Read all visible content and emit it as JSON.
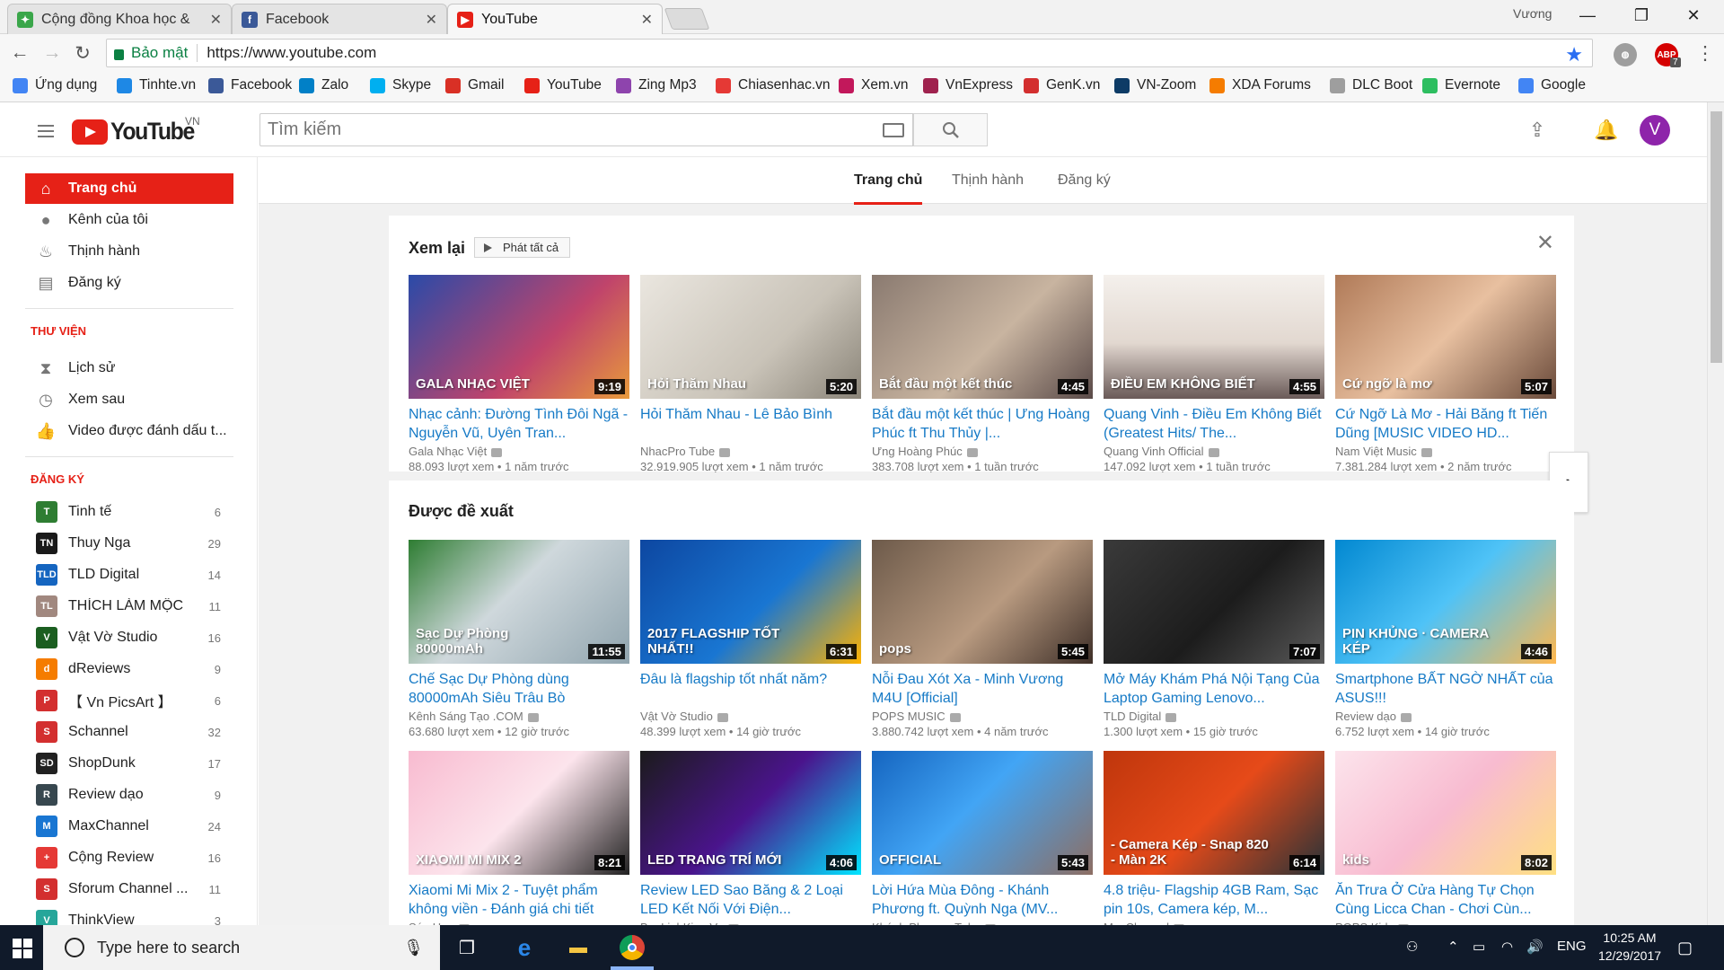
{
  "tabs": [
    {
      "title": "Cộng đồng Khoa học &",
      "favicon": "community-icon",
      "color": "#3aa64a"
    },
    {
      "title": "Facebook",
      "favicon": "facebook-icon",
      "color": "#3b5998"
    },
    {
      "title": "YouTube",
      "favicon": "youtube-icon",
      "color": "#e62117"
    }
  ],
  "window": {
    "user": "Vương"
  },
  "address": {
    "secure_label": "Bảo mật",
    "url": "https://www.youtube.com"
  },
  "extensions": {
    "abp_label": "ABP",
    "abp_badge": "7"
  },
  "bookmarks": [
    {
      "label": "Ứng dụng",
      "icon": "apps-icon",
      "color": "#4285f4"
    },
    {
      "label": "Tinhte.vn",
      "icon": "tinhte-icon",
      "color": "#1e88e5"
    },
    {
      "label": "Facebook",
      "icon": "facebook-icon",
      "color": "#3b5998"
    },
    {
      "label": "Zalo",
      "icon": "zalo-icon",
      "color": "#0180c7"
    },
    {
      "label": "Skype",
      "icon": "skype-icon",
      "color": "#00aff0"
    },
    {
      "label": "Gmail",
      "icon": "gmail-icon",
      "color": "#d93025"
    },
    {
      "label": "YouTube",
      "icon": "youtube-icon",
      "color": "#e62117"
    },
    {
      "label": "Zing Mp3",
      "icon": "zingmp3-icon",
      "color": "#8e44ad"
    },
    {
      "label": "Chiasenhac.vn",
      "icon": "chiasenhac-icon",
      "color": "#e53935"
    },
    {
      "label": "Xem.vn",
      "icon": "xemvn-icon",
      "color": "#c2185b"
    },
    {
      "label": "VnExpress",
      "icon": "vnexpress-icon",
      "color": "#9f224e"
    },
    {
      "label": "GenK.vn",
      "icon": "genk-icon",
      "color": "#d32f2f"
    },
    {
      "label": "VN-Zoom",
      "icon": "vnzoom-icon",
      "color": "#0d3b66"
    },
    {
      "label": "XDA Forums",
      "icon": "xda-icon",
      "color": "#f57c00"
    },
    {
      "label": "DLC Boot",
      "icon": "document-icon",
      "color": "#9e9e9e"
    },
    {
      "label": "Evernote",
      "icon": "evernote-icon",
      "color": "#2dbe60"
    },
    {
      "label": "Google",
      "icon": "google-icon",
      "color": "#4285f4"
    }
  ],
  "yt": {
    "logo_text": "YouTube",
    "region": "VN",
    "search_placeholder": "Tìm kiếm",
    "avatar_letter": "V",
    "accent": "#e62117"
  },
  "sidebar": {
    "main_items": [
      {
        "label": "Trang chủ",
        "icon": "home-icon",
        "glyph": "⌂"
      },
      {
        "label": "Kênh của tôi",
        "icon": "account-icon",
        "glyph": "●"
      },
      {
        "label": "Thịnh hành",
        "icon": "trending-flame-icon",
        "glyph": "♨"
      },
      {
        "label": "Đăng ký",
        "icon": "subscriptions-icon",
        "glyph": "▤"
      }
    ],
    "library_header": "THƯ VIỆN",
    "library_items": [
      {
        "label": "Lịch sử",
        "icon": "history-hourglass-icon",
        "glyph": "⧗"
      },
      {
        "label": "Xem sau",
        "icon": "watch-later-clock-icon",
        "glyph": "◷"
      },
      {
        "label": "Video được đánh dấu t...",
        "icon": "thumbs-up-icon",
        "glyph": "👍"
      }
    ],
    "subs_header": "ĐĂNG KÝ",
    "subscriptions": [
      {
        "name": "Tinh tế",
        "count": "6",
        "color": "#2e7d32",
        "short": "T"
      },
      {
        "name": "Thuy Nga",
        "count": "29",
        "color": "#1a1a1a",
        "short": "TN"
      },
      {
        "name": "TLD Digital",
        "count": "14",
        "color": "#1565c0",
        "short": "TLD"
      },
      {
        "name": "THÍCH LÀM MỘC",
        "count": "11",
        "color": "#a1887f",
        "short": "TL"
      },
      {
        "name": "Vật Vờ Studio",
        "count": "16",
        "color": "#1b5e20",
        "short": "V"
      },
      {
        "name": "dReviews",
        "count": "9",
        "color": "#f57c00",
        "short": "d"
      },
      {
        "name": "【 Vn PicsArt 】",
        "count": "6",
        "color": "#d32f2f",
        "short": "P"
      },
      {
        "name": "Schannel",
        "count": "32",
        "color": "#d32f2f",
        "short": "S"
      },
      {
        "name": "ShopDunk",
        "count": "17",
        "color": "#212121",
        "short": "SD"
      },
      {
        "name": "Review dạo",
        "count": "9",
        "color": "#37474f",
        "short": "R"
      },
      {
        "name": "MaxChannel",
        "count": "24",
        "color": "#1976d2",
        "short": "M"
      },
      {
        "name": "Cộng Review",
        "count": "16",
        "color": "#e53935",
        "short": "+"
      },
      {
        "name": "Sforum Channel ...",
        "count": "11",
        "color": "#d32f2f",
        "short": "S"
      },
      {
        "name": "ThinkView",
        "count": "3",
        "color": "#26a69a",
        "short": "V"
      }
    ]
  },
  "feed_tabs": [
    "Trang chủ",
    "Thịnh hành",
    "Đăng ký"
  ],
  "shelf1": {
    "title": "Xem lại",
    "play_all": "Phát tất cả",
    "videos": [
      {
        "title": "Nhạc cảnh: Đường Tình Đôi Ngã - Nguyễn Vũ, Uyên Tran...",
        "channel": "Gala Nhạc Việt",
        "views": "88.093 lượt xem",
        "age": "1 năm trước",
        "duration": "9:19",
        "bg": "linear-gradient(135deg,#2a4aa8,#c0446b 60%,#e89a3b)",
        "overlay": "GALA NHẠC VIỆT"
      },
      {
        "title": "Hỏi Thăm Nhau - Lê Bảo Bình",
        "channel": "NhacPro Tube",
        "views": "32.919.905 lượt xem",
        "age": "1 năm trước",
        "duration": "5:20",
        "bg": "linear-gradient(135deg,#eae6df,#c9c3b8 60%,#8a8478)",
        "overlay": "Hỏi Thăm Nhau"
      },
      {
        "title": "Bắt đầu một kết thúc | Ưng Hoàng Phúc ft Thu Thủy |...",
        "channel": "Ưng Hoàng Phúc",
        "views": "383.708 lượt xem",
        "age": "1 tuần trước",
        "duration": "4:45",
        "bg": "linear-gradient(135deg,#8a7a70,#c8b4a0 55%,#5a4a48)",
        "overlay": "Bắt đầu một kết thúc"
      },
      {
        "title": "Quang Vinh - Điều Em Không Biết (Greatest Hits/ The...",
        "channel": "Quang Vinh Official",
        "views": "147.092 lượt xem",
        "age": "1 tuần trước",
        "duration": "4:55",
        "bg": "linear-gradient(180deg,#f4f0ec,#e2d8d0 55%,#6a5a58)",
        "overlay": "ĐIỀU EM KHÔNG BIẾT"
      },
      {
        "title": "Cứ Ngỡ Là Mơ - Hải Băng ft Tiến Dũng [MUSIC VIDEO HD...",
        "channel": "Nam Việt Music",
        "views": "7.381.284 lượt xem",
        "age": "2 năm trước",
        "duration": "5:07",
        "bg": "linear-gradient(135deg,#b07a58,#e8c0a0 50%,#6a4a3a)",
        "overlay": "Cứ ngỡ là mơ"
      }
    ]
  },
  "shelf2": {
    "title": "Được đề xuất",
    "row1": [
      {
        "title": "Chế Sạc Dự Phòng dùng 80000mAh Siêu Trâu Bò",
        "channel": "Kênh Sáng Tạo .COM",
        "views": "63.680 lượt xem",
        "age": "12 giờ trước",
        "duration": "11:55",
        "bg": "linear-gradient(135deg,#2e7d32,#cfd8dc 45%,#90a4ae)",
        "overlay": "Sạc Dự Phòng 80000mAh"
      },
      {
        "title": "Đâu là flagship tốt nhất năm?",
        "channel": "Vật Vờ Studio",
        "views": "48.399 lượt xem",
        "age": "14 giờ trước",
        "duration": "6:31",
        "bg": "linear-gradient(135deg,#0d47a1,#1976d2 55%,#ffb300)",
        "overlay": "2017 FLAGSHIP TỐT NHẤT!!"
      },
      {
        "title": "Nỗi Đau Xót Xa - Minh Vương M4U [Official]",
        "channel": "POPS MUSIC",
        "views": "3.880.742 lượt xem",
        "age": "4 năm trước",
        "duration": "5:45",
        "bg": "linear-gradient(135deg,#6d5a4a,#b89a80 55%,#3e2f28)",
        "overlay": "pops"
      },
      {
        "title": "Mở Máy Khám Phá Nội Tạng Của Laptop Gaming Lenovo...",
        "channel": "TLD Digital",
        "views": "1.300 lượt xem",
        "age": "15 giờ trước",
        "duration": "7:07",
        "bg": "linear-gradient(135deg,#3a3a3a,#1c1c1c 55%,#5a5a5a)",
        "overlay": ""
      },
      {
        "title": "Smartphone BẤT NGỜ NHẤT của ASUS!!!",
        "channel": "Review dạo",
        "views": "6.752 lượt xem",
        "age": "14 giờ trước",
        "duration": "4:46",
        "bg": "linear-gradient(135deg,#0288d1,#4fc3f7 50%,#ffb74d)",
        "overlay": "PIN KHỦNG · CAMERA KÉP"
      }
    ],
    "row2": [
      {
        "title": "Xiaomi Mi Mix 2 - Tuyệt phẩm không viền - Đánh giá chi tiết",
        "channel": "Súp Heo",
        "views": "",
        "age": "",
        "duration": "8:21",
        "bg": "linear-gradient(135deg,#f8bbd0,#fce4ec 50%,#212121)",
        "overlay": "XIAOMI MI MIX 2"
      },
      {
        "title": "Review LED Sao Băng & 2 Loại LED Kết Nối Với Điện...",
        "channel": "BanLinhKien.Vn",
        "views": "",
        "age": "",
        "duration": "4:06",
        "bg": "linear-gradient(135deg,#1b1b1b,#4a148c 50%,#00e5ff)",
        "overlay": "LED TRANG TRÍ MỚI"
      },
      {
        "title": "Lời Hứa Mùa Đông - Khánh Phương ft. Quỳnh Nga (MV...",
        "channel": "Khánh Phương Tube",
        "views": "",
        "age": "",
        "duration": "5:43",
        "bg": "linear-gradient(135deg,#1565c0,#42a5f5 45%,#8d6e63)",
        "overlay": "OFFICIAL"
      },
      {
        "title": "4.8 triệu- Flagship 4GB Ram, Sạc pin 10s, Camera kép, M...",
        "channel": "MaxChannel",
        "views": "",
        "age": "",
        "duration": "6:14",
        "bg": "linear-gradient(135deg,#bf360c,#e64a19 50%,#263238)",
        "overlay": "- Camera Kép - Snap 820 - Màn 2K"
      },
      {
        "title": "Ăn Trưa Ở Cửa Hàng Tự Chọn Cùng Licca Chan - Chơi Cùn...",
        "channel": "POPS Kids",
        "views": "",
        "age": "",
        "duration": "8:02",
        "bg": "linear-gradient(135deg,#fce4ec,#f8bbd0 50%,#ffe082)",
        "overlay": "kids"
      }
    ]
  },
  "taskbar": {
    "search_placeholder": "Type here to search",
    "lang": "ENG",
    "time": "10:25 AM",
    "date": "12/29/2017"
  }
}
